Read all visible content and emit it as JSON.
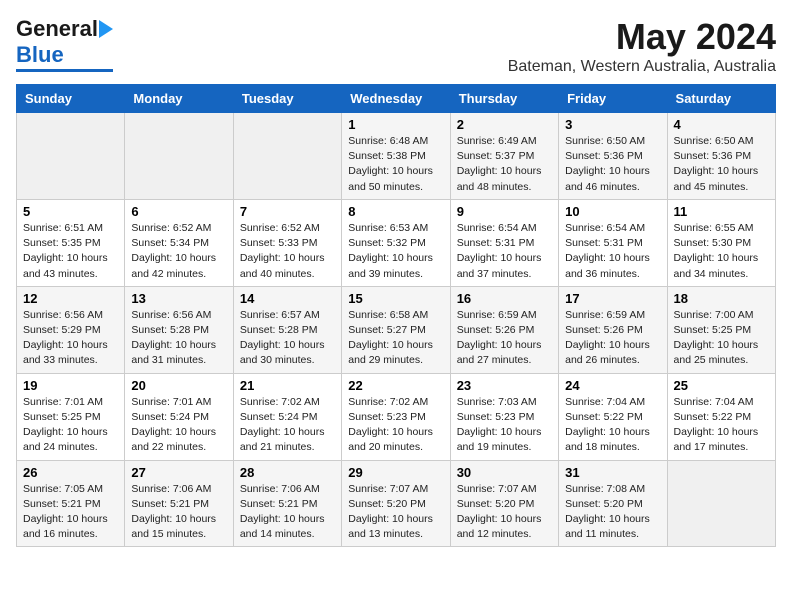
{
  "header": {
    "logo_general": "General",
    "logo_blue": "Blue",
    "month": "May 2024",
    "location": "Bateman, Western Australia, Australia"
  },
  "calendar": {
    "days_of_week": [
      "Sunday",
      "Monday",
      "Tuesday",
      "Wednesday",
      "Thursday",
      "Friday",
      "Saturday"
    ],
    "weeks": [
      [
        {
          "day": "",
          "info": ""
        },
        {
          "day": "",
          "info": ""
        },
        {
          "day": "",
          "info": ""
        },
        {
          "day": "1",
          "info": "Sunrise: 6:48 AM\nSunset: 5:38 PM\nDaylight: 10 hours\nand 50 minutes."
        },
        {
          "day": "2",
          "info": "Sunrise: 6:49 AM\nSunset: 5:37 PM\nDaylight: 10 hours\nand 48 minutes."
        },
        {
          "day": "3",
          "info": "Sunrise: 6:50 AM\nSunset: 5:36 PM\nDaylight: 10 hours\nand 46 minutes."
        },
        {
          "day": "4",
          "info": "Sunrise: 6:50 AM\nSunset: 5:36 PM\nDaylight: 10 hours\nand 45 minutes."
        }
      ],
      [
        {
          "day": "5",
          "info": "Sunrise: 6:51 AM\nSunset: 5:35 PM\nDaylight: 10 hours\nand 43 minutes."
        },
        {
          "day": "6",
          "info": "Sunrise: 6:52 AM\nSunset: 5:34 PM\nDaylight: 10 hours\nand 42 minutes."
        },
        {
          "day": "7",
          "info": "Sunrise: 6:52 AM\nSunset: 5:33 PM\nDaylight: 10 hours\nand 40 minutes."
        },
        {
          "day": "8",
          "info": "Sunrise: 6:53 AM\nSunset: 5:32 PM\nDaylight: 10 hours\nand 39 minutes."
        },
        {
          "day": "9",
          "info": "Sunrise: 6:54 AM\nSunset: 5:31 PM\nDaylight: 10 hours\nand 37 minutes."
        },
        {
          "day": "10",
          "info": "Sunrise: 6:54 AM\nSunset: 5:31 PM\nDaylight: 10 hours\nand 36 minutes."
        },
        {
          "day": "11",
          "info": "Sunrise: 6:55 AM\nSunset: 5:30 PM\nDaylight: 10 hours\nand 34 minutes."
        }
      ],
      [
        {
          "day": "12",
          "info": "Sunrise: 6:56 AM\nSunset: 5:29 PM\nDaylight: 10 hours\nand 33 minutes."
        },
        {
          "day": "13",
          "info": "Sunrise: 6:56 AM\nSunset: 5:28 PM\nDaylight: 10 hours\nand 31 minutes."
        },
        {
          "day": "14",
          "info": "Sunrise: 6:57 AM\nSunset: 5:28 PM\nDaylight: 10 hours\nand 30 minutes."
        },
        {
          "day": "15",
          "info": "Sunrise: 6:58 AM\nSunset: 5:27 PM\nDaylight: 10 hours\nand 29 minutes."
        },
        {
          "day": "16",
          "info": "Sunrise: 6:59 AM\nSunset: 5:26 PM\nDaylight: 10 hours\nand 27 minutes."
        },
        {
          "day": "17",
          "info": "Sunrise: 6:59 AM\nSunset: 5:26 PM\nDaylight: 10 hours\nand 26 minutes."
        },
        {
          "day": "18",
          "info": "Sunrise: 7:00 AM\nSunset: 5:25 PM\nDaylight: 10 hours\nand 25 minutes."
        }
      ],
      [
        {
          "day": "19",
          "info": "Sunrise: 7:01 AM\nSunset: 5:25 PM\nDaylight: 10 hours\nand 24 minutes."
        },
        {
          "day": "20",
          "info": "Sunrise: 7:01 AM\nSunset: 5:24 PM\nDaylight: 10 hours\nand 22 minutes."
        },
        {
          "day": "21",
          "info": "Sunrise: 7:02 AM\nSunset: 5:24 PM\nDaylight: 10 hours\nand 21 minutes."
        },
        {
          "day": "22",
          "info": "Sunrise: 7:02 AM\nSunset: 5:23 PM\nDaylight: 10 hours\nand 20 minutes."
        },
        {
          "day": "23",
          "info": "Sunrise: 7:03 AM\nSunset: 5:23 PM\nDaylight: 10 hours\nand 19 minutes."
        },
        {
          "day": "24",
          "info": "Sunrise: 7:04 AM\nSunset: 5:22 PM\nDaylight: 10 hours\nand 18 minutes."
        },
        {
          "day": "25",
          "info": "Sunrise: 7:04 AM\nSunset: 5:22 PM\nDaylight: 10 hours\nand 17 minutes."
        }
      ],
      [
        {
          "day": "26",
          "info": "Sunrise: 7:05 AM\nSunset: 5:21 PM\nDaylight: 10 hours\nand 16 minutes."
        },
        {
          "day": "27",
          "info": "Sunrise: 7:06 AM\nSunset: 5:21 PM\nDaylight: 10 hours\nand 15 minutes."
        },
        {
          "day": "28",
          "info": "Sunrise: 7:06 AM\nSunset: 5:21 PM\nDaylight: 10 hours\nand 14 minutes."
        },
        {
          "day": "29",
          "info": "Sunrise: 7:07 AM\nSunset: 5:20 PM\nDaylight: 10 hours\nand 13 minutes."
        },
        {
          "day": "30",
          "info": "Sunrise: 7:07 AM\nSunset: 5:20 PM\nDaylight: 10 hours\nand 12 minutes."
        },
        {
          "day": "31",
          "info": "Sunrise: 7:08 AM\nSunset: 5:20 PM\nDaylight: 10 hours\nand 11 minutes."
        },
        {
          "day": "",
          "info": ""
        }
      ]
    ]
  }
}
